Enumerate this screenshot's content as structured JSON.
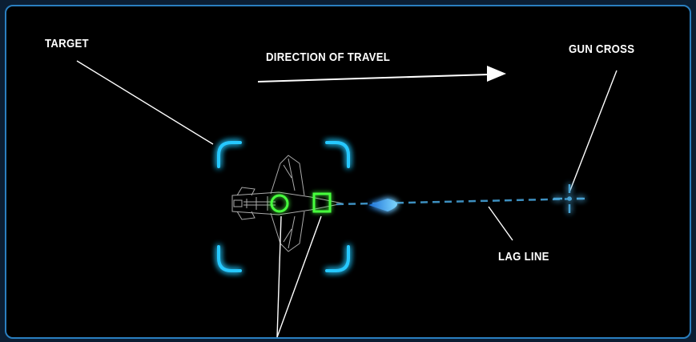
{
  "labels": {
    "target": "TARGET",
    "direction": "DIRECTION OF TRAVEL",
    "gun_cross": "GUN CROSS",
    "lag_line": "LAG LINE"
  },
  "colors": {
    "background": "#000000",
    "frame_border": "#2a7fc0",
    "bracket": "#27c8ff",
    "pipper": "#46ff3c",
    "lag_line": "#3d8fbf",
    "callout": "#ffffff"
  },
  "icons": {
    "target_box": "corner-brackets",
    "aircraft": "fighter-jet-wireframe-icon",
    "pipper_circle": "circle-reticle-icon",
    "pipper_square": "square-reticle-icon",
    "gun_cross": "crosshair-icon",
    "direction_arrow": "arrow-right-icon"
  }
}
